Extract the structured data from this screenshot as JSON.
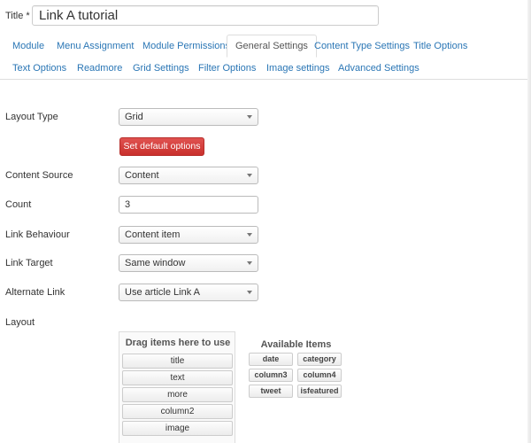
{
  "title_field": {
    "label": "Title *",
    "value": "Link A tutorial"
  },
  "tabs": {
    "row1": [
      "Module",
      "Menu Assignment",
      "Module Permissions",
      "General Settings",
      "Content Type Settings",
      "Title Options"
    ],
    "row2": [
      "Text Options",
      "Readmore",
      "Grid Settings",
      "Filter Options",
      "Image settings",
      "Advanced Settings"
    ],
    "active": "General Settings"
  },
  "form": {
    "layout_type": {
      "label": "Layout Type",
      "value": "Grid"
    },
    "set_default_button": "Set default options",
    "content_source": {
      "label": "Content Source",
      "value": "Content"
    },
    "count": {
      "label": "Count",
      "value": "3"
    },
    "link_behaviour": {
      "label": "Link Behaviour",
      "value": "Content item"
    },
    "link_target": {
      "label": "Link Target",
      "value": "Same window"
    },
    "alternate_link": {
      "label": "Alternate Link",
      "value": "Use article Link A"
    },
    "layout": {
      "label": "Layout"
    }
  },
  "layout_builder": {
    "drag_title": "Drag items here to use",
    "used_items": [
      "title",
      "text",
      "more",
      "column2",
      "image"
    ],
    "available_title": "Available Items",
    "available_items": [
      "date",
      "category",
      "column3",
      "column4",
      "tweet",
      "isfeatured"
    ]
  },
  "colors": {
    "link": "#2a76b5",
    "danger": "#c9302c"
  }
}
